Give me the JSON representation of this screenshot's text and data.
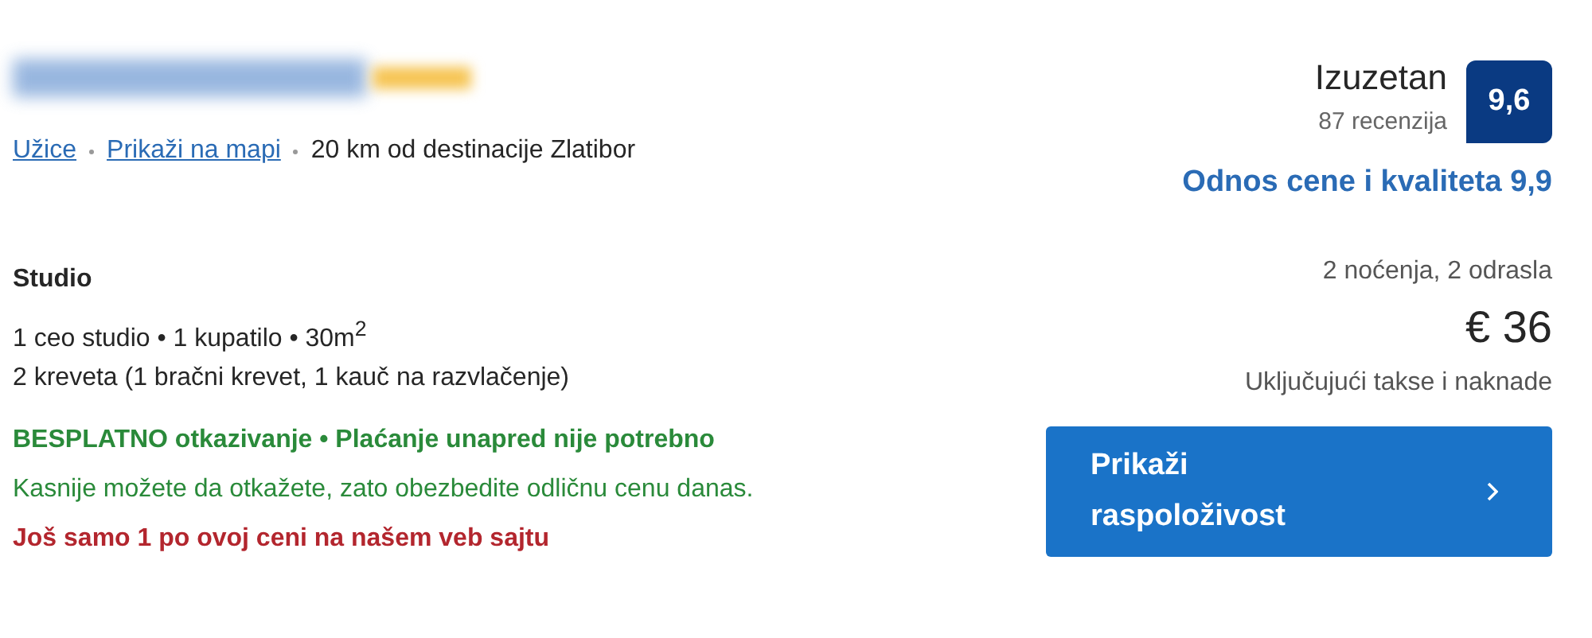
{
  "location": {
    "city": "Užice",
    "map_link": "Prikaži na mapi",
    "distance": "20 km od destinacije Zlatibor"
  },
  "room": {
    "name": "Studio",
    "details": "1 ceo studio • 1 kupatilo • 30m$^{2}$",
    "beds": "2 kreveta (1 bračni krevet, 1 kauč na razvlačenje)"
  },
  "cancellation": {
    "headline": "BESPLATNO otkazivanje • Plaćanje unapred nije potrebno",
    "note": "Kasnije možete da otkažete, zato obezbedite odličnu cenu danas."
  },
  "scarcity": "Još samo 1 po ovoj ceni na našem veb sajtu",
  "rating": {
    "label": "Izuzetan",
    "reviews": "87 recenzija",
    "score": "9,6",
    "value_for_money": "Odnos cene i kvaliteta 9,9"
  },
  "price": {
    "stay": "2 noćenja, 2 odrasla",
    "amount": "€ 36",
    "taxes": "Uključujući takse i naknade"
  },
  "button": "Prikaži raspoloživost"
}
